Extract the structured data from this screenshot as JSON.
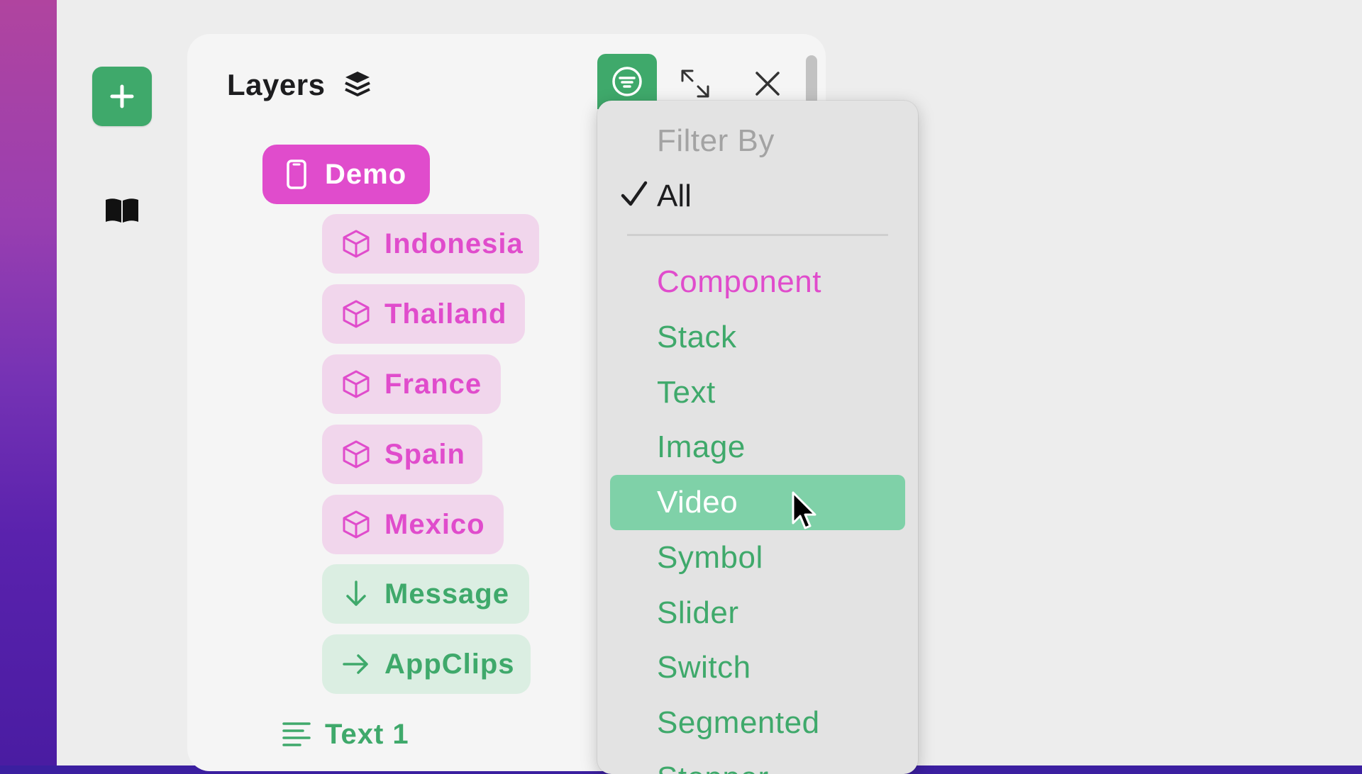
{
  "panel": {
    "title": "Layers"
  },
  "layers": [
    {
      "name": "Demo",
      "kind": "root",
      "icon": "phone-icon"
    },
    {
      "name": "Indonesia",
      "kind": "component",
      "icon": "cube-icon"
    },
    {
      "name": "Thailand",
      "kind": "component",
      "icon": "cube-icon"
    },
    {
      "name": "France",
      "kind": "component",
      "icon": "cube-icon"
    },
    {
      "name": "Spain",
      "kind": "component",
      "icon": "cube-icon"
    },
    {
      "name": "Mexico",
      "kind": "component",
      "icon": "cube-icon"
    },
    {
      "name": "Message",
      "kind": "stack",
      "icon": "arrow-down-icon"
    },
    {
      "name": "AppClips",
      "kind": "stack",
      "icon": "arrow-right-icon"
    },
    {
      "name": "Text 1",
      "kind": "text",
      "icon": "text-lines-icon"
    }
  ],
  "filter_menu": {
    "header": "Filter By",
    "selected_option": "All",
    "options": [
      "Component",
      "Stack",
      "Text",
      "Image",
      "Video",
      "Symbol",
      "Slider",
      "Switch",
      "Segmented",
      "Stepper"
    ],
    "highlighted": "Video"
  },
  "colors": {
    "accent_green": "#3fa96b",
    "accent_pink": "#e04ccc",
    "highlight_green": "#7fd1a8"
  }
}
